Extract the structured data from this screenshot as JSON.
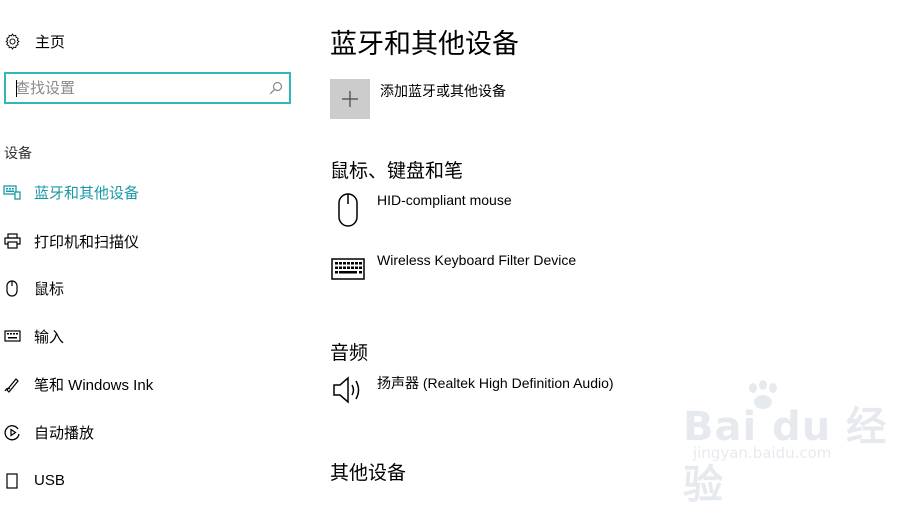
{
  "sidebar": {
    "home_label": "主页",
    "search": {
      "placeholder": "查找设置",
      "value": ""
    },
    "section_label": "设备",
    "items": [
      {
        "label": "蓝牙和其他设备",
        "icon": "bluetooth-devices-icon",
        "active": true
      },
      {
        "label": "打印机和扫描仪",
        "icon": "printer-icon",
        "active": false
      },
      {
        "label": "鼠标",
        "icon": "mouse-icon",
        "active": false
      },
      {
        "label": "输入",
        "icon": "keyboard-icon",
        "active": false
      },
      {
        "label": "笔和 Windows Ink",
        "icon": "pen-icon",
        "active": false
      },
      {
        "label": "自动播放",
        "icon": "autoplay-icon",
        "active": false
      },
      {
        "label": "USB",
        "icon": "usb-icon",
        "active": false
      }
    ]
  },
  "main": {
    "title": "蓝牙和其他设备",
    "add_device_label": "添加蓝牙或其他设备",
    "groups": {
      "mouse_keyboard_pen": {
        "title": "鼠标、键盘和笔",
        "devices": [
          "HID-compliant mouse",
          "Wireless Keyboard Filter Device"
        ]
      },
      "audio": {
        "title": "音频",
        "devices": [
          "扬声器 (Realtek High Definition Audio)"
        ]
      },
      "other": {
        "title": "其他设备"
      }
    }
  },
  "watermark": {
    "main": "Bai du 经验",
    "sub": "jingyan.baidu.com"
  },
  "colors": {
    "accent": "#1a9aa6",
    "search_border": "#2eb8b8",
    "tile": "#cccccc"
  }
}
